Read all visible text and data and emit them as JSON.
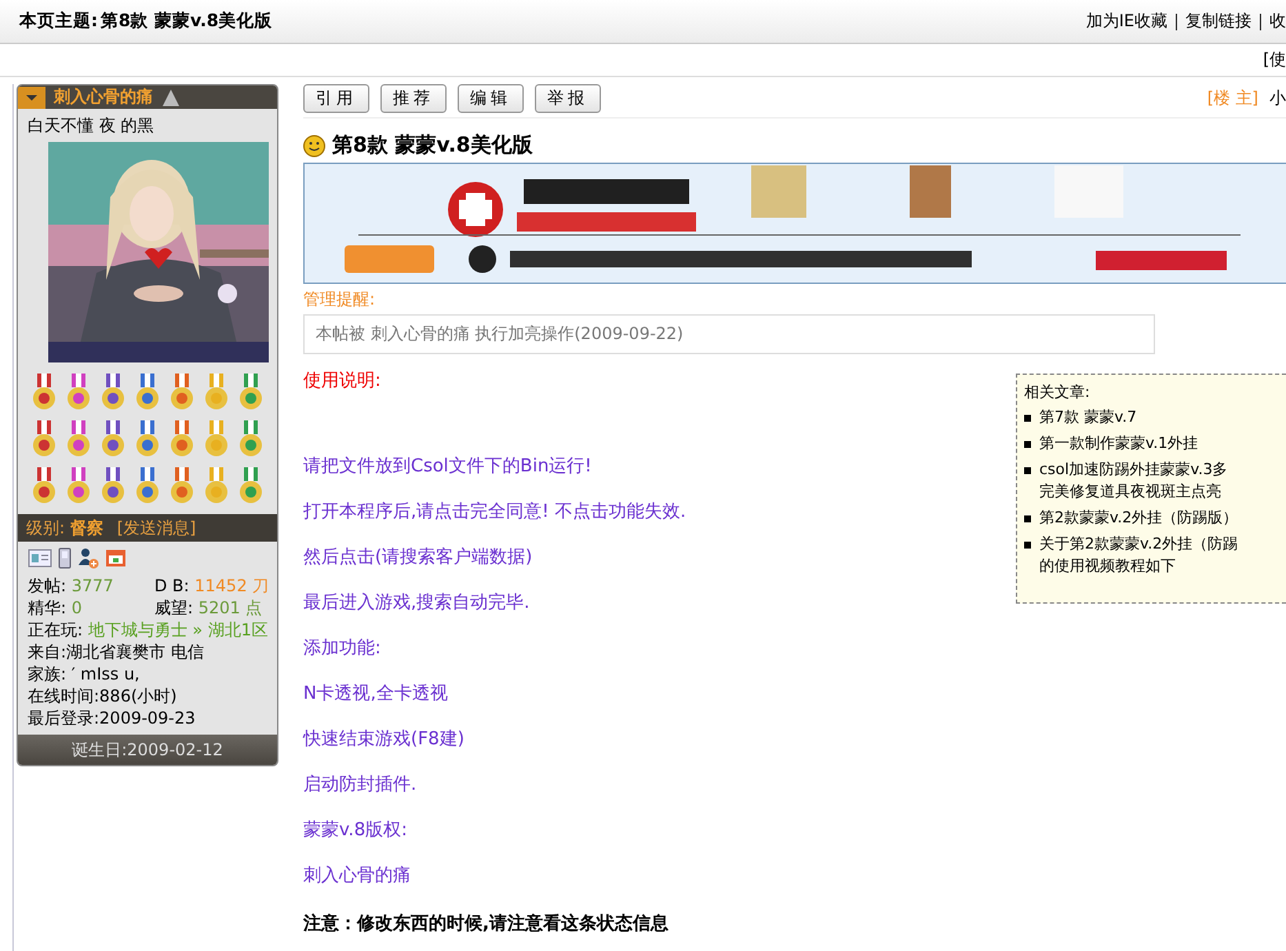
{
  "topbar": {
    "title_label": "本页主题:",
    "title": "第8款  蒙蒙v.8美化版",
    "links": [
      "加为IE收藏",
      "复制链接",
      "收"
    ]
  },
  "subbar": {
    "text": "[使"
  },
  "author": {
    "name": "刺入心骨的痛",
    "signature": "白天不懂 夜 的黑",
    "avatar": {
      "kind": "picture"
    },
    "rank_label": "级别:",
    "rank": "督察",
    "message_link": "[发送消息]",
    "stat_pairs": [
      {
        "label": "发帖:",
        "value": "3777",
        "color": "#6b9a3a"
      },
      {
        "label": "D B:",
        "value": "11452 刀",
        "color": "#f08a24"
      },
      {
        "label": "精华:",
        "value": "0",
        "color": "#6b9a3a"
      },
      {
        "label": "威望:",
        "value": "5201 点",
        "color": "#6b9a3a"
      }
    ],
    "playing": {
      "label": "正在玩:",
      "value": "地下城与勇士 » 湖北1区",
      "color": "#58a020"
    },
    "info_lines": [
      "来自:湖北省襄樊市 电信",
      "家族: ′ mIss u,",
      "在线时间:886(小时)",
      "最后登录:2009-09-23"
    ],
    "birthday": "诞生日:2009-02-12"
  },
  "post": {
    "buttons": [
      "引用",
      "推荐",
      "编辑",
      "举报"
    ],
    "floor": "[楼 主]",
    "floor_cut": "小",
    "title": "第8款  蒙蒙v.8美化版",
    "banner": {
      "kind": "picture"
    },
    "notice": {
      "label": "管理提醒:",
      "text": "本帖被 刺入心骨的痛 执行加亮操作(2009-09-22)"
    },
    "heading": "使用说明:",
    "lines": [
      "请把文件放到Csol文件下的Bin运行!",
      "打开本程序后,请点击完全同意! 不点击功能失效.",
      "然后点击(请搜索客户端数据)",
      "最后进入游戏,搜索自动完毕.",
      "添加功能:",
      "N卡透视,全卡透视",
      "快速结束游戏(F8建)",
      "启动防封插件.",
      "蒙蒙v.8版权:",
      "刺入心骨的痛"
    ],
    "note": "注意：修改东西的时候,请注意看这条状态信息"
  },
  "related": {
    "title": "相关文章:",
    "items": [
      {
        "lines": [
          "第7款 蒙蒙v.7"
        ]
      },
      {
        "lines": [
          "第一款制作蒙蒙v.1外挂"
        ]
      },
      {
        "lines": [
          "csol加速防踢外挂蒙蒙v.3多",
          "完美修复道具夜视斑主点亮"
        ]
      },
      {
        "lines": [
          "第2款蒙蒙v.2外挂（防踢版）"
        ]
      },
      {
        "lines": [
          "关于第2款蒙蒙v.2外挂（防踢",
          "的使用视频教程如下"
        ]
      }
    ]
  }
}
